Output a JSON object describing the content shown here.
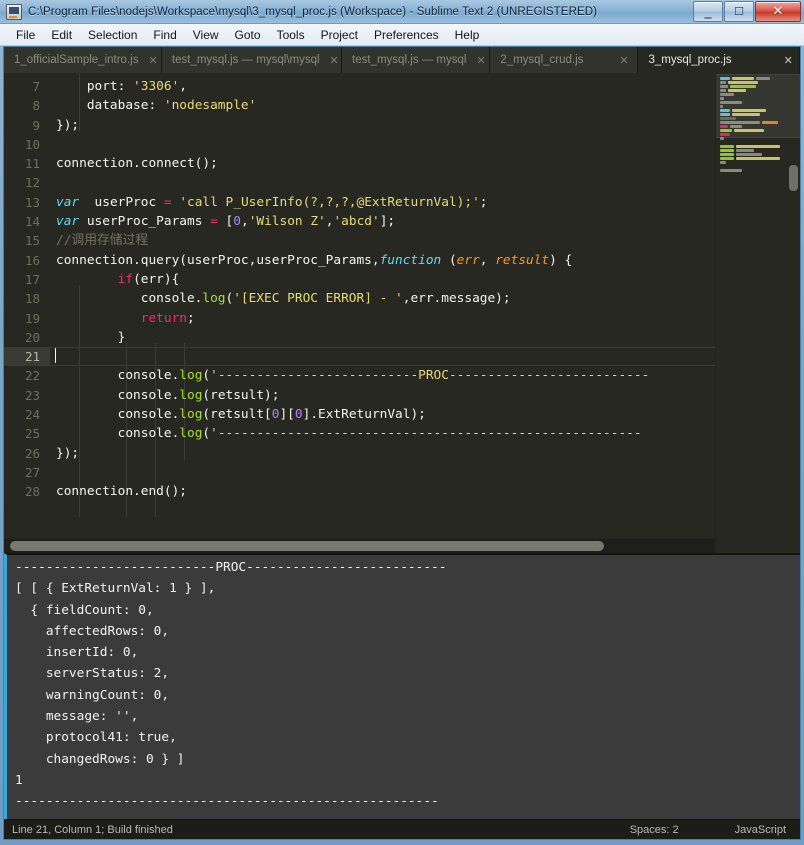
{
  "window": {
    "title": "C:\\Program Files\\nodejs\\Workspace\\mysql\\3_mysql_proc.js (Workspace) - Sublime Text 2 (UNREGISTERED)",
    "app_icon": "sublime-text-icon",
    "controls": {
      "minimize": "—",
      "maximize": "□",
      "close": "✕"
    }
  },
  "menubar": {
    "items": [
      {
        "label": "File"
      },
      {
        "label": "Edit"
      },
      {
        "label": "Selection"
      },
      {
        "label": "Find"
      },
      {
        "label": "View"
      },
      {
        "label": "Goto"
      },
      {
        "label": "Tools"
      },
      {
        "label": "Project"
      },
      {
        "label": "Preferences"
      },
      {
        "label": "Help"
      }
    ]
  },
  "tabs": [
    {
      "label": "1_officialSample_intro.js",
      "close": "✕",
      "active": false
    },
    {
      "label": "test_mysql.js — mysql\\mysql",
      "close": "✕",
      "active": false
    },
    {
      "label": "test_mysql.js — mysql",
      "close": "✕",
      "active": false
    },
    {
      "label": "2_mysql_crud.js",
      "close": "✕",
      "active": false
    },
    {
      "label": "3_mysql_proc.js",
      "close": "✕",
      "active": true
    }
  ],
  "editor": {
    "first_line_number": 7,
    "current_line": 21,
    "line_numbers": [
      7,
      8,
      9,
      10,
      11,
      12,
      13,
      14,
      15,
      16,
      17,
      18,
      19,
      20,
      21,
      22,
      23,
      24,
      25,
      26,
      27,
      28
    ],
    "lines": [
      "    port: '3306',",
      "    database: 'nodesample'",
      "});",
      "",
      "connection.connect();",
      "",
      "var  userProc = 'call P_UserInfo(?,?,?,@ExtReturnVal);';",
      "var userProc_Params = [0,'Wilson Z','abcd'];",
      "//调用存储过程",
      "connection.query(userProc,userProc_Params,function (err, retsult) {",
      "        if(err){",
      "           console.log('[EXEC PROC ERROR] - ',err.message);",
      "           return;",
      "        }",
      "",
      "        console.log('--------------------------PROC--------------------------",
      "        console.log(retsult);",
      "        console.log(retsult[0][0].ExtReturnVal);",
      "        console.log('-------------------------------------------------------",
      "});",
      "",
      "connection.end();"
    ]
  },
  "console": {
    "lines": [
      "--------------------------PROC--------------------------",
      "[ [ { ExtReturnVal: 1 } ],",
      "  { fieldCount: 0,",
      "    affectedRows: 0,",
      "    insertId: 0,",
      "    serverStatus: 2,",
      "    warningCount: 0,",
      "    message: '',",
      "    protocol41: true,",
      "    changedRows: 0 } ]",
      "1",
      "-------------------------------------------------------"
    ]
  },
  "statusbar": {
    "left": "Line 21, Column 1; Build finished",
    "indentation": "Spaces: 2",
    "syntax": "JavaScript"
  },
  "colors": {
    "editor_bg": "#272822",
    "console_bg": "#3b3b3b",
    "accent": "#3aa7dd",
    "keyword": "#F92672",
    "string": "#E6DB74",
    "function": "#A6E22E",
    "type": "#66D9EF",
    "number": "#AE81FF",
    "param": "#FD971F",
    "comment": "#75715E"
  }
}
